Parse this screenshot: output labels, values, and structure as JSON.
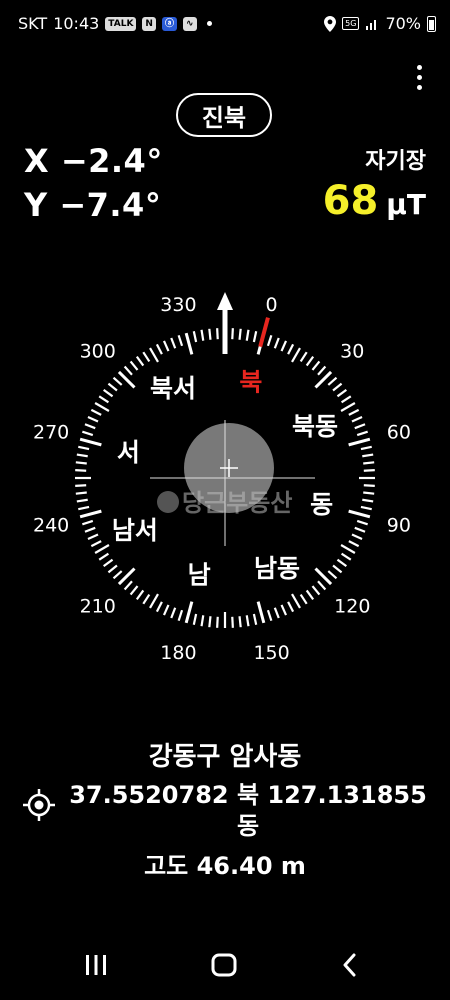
{
  "status_bar": {
    "carrier": "SKT",
    "time": "10:43",
    "notification_icons": [
      "talk-icon",
      "naver-icon",
      "app-icon",
      "shortcut-icon"
    ],
    "notification_labels": [
      "TALK",
      "N",
      "ⓐ",
      "∿"
    ],
    "network": "5G",
    "battery": "70%"
  },
  "header": {
    "mode_button_label": "진북",
    "menu_icon": "more-vertical-icon"
  },
  "tilt": {
    "x_text": "X −2.4°",
    "y_text": "Y −7.4°"
  },
  "magnetic_field": {
    "label": "자기장",
    "value": "68",
    "unit": "μT",
    "value_color": "#f5ef2a"
  },
  "compass": {
    "heading_deg": 345,
    "north_color": "#e8261f",
    "degree_labels": [
      "0",
      "30",
      "60",
      "90",
      "120",
      "150",
      "180",
      "210",
      "240",
      "270",
      "300",
      "330"
    ],
    "direction_labels": [
      "북",
      "북동",
      "동",
      "남동",
      "남",
      "남서",
      "서",
      "북서"
    ],
    "watermark": "당근부동산"
  },
  "location": {
    "address": "강동구 암사동",
    "coordinates_line1": "37.5520782 북  127.131855",
    "coordinates_line2": "동",
    "altitude": "고도 46.40 m"
  },
  "nav_bar": {
    "buttons": [
      "recent-apps-icon",
      "home-icon",
      "back-icon"
    ]
  }
}
